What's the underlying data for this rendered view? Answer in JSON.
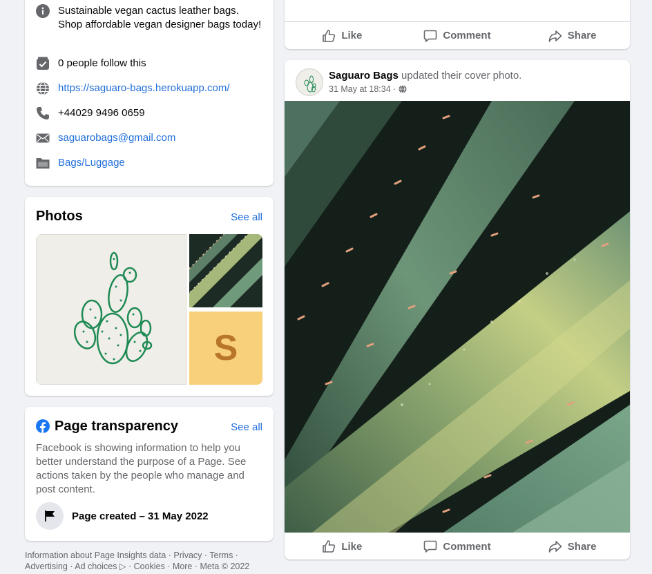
{
  "about": {
    "description": "Sustainable vegan cactus leather bags. Shop affordable vegan designer bags today!",
    "followers": "0 people follow this",
    "website": "https://saguaro-bags.herokuapp.com/",
    "phone": "+44029 9496 0659",
    "email": "saguarobags@gmail.com",
    "category": "Bags/Luggage"
  },
  "photos": {
    "title": "Photos",
    "see_all": "See all",
    "tile_letter": "S"
  },
  "transparency": {
    "title": "Page transparency",
    "see_all": "See all",
    "body": "Facebook is showing information to help you better understand the purpose of a Page. See actions taken by the people who manage and post content.",
    "created": "Page created – 31 May 2022"
  },
  "footer": {
    "links": [
      "Information about Page Insights data",
      "Privacy",
      "Terms",
      "Advertising",
      "Ad choices",
      "Cookies",
      "More"
    ],
    "copyright": "Meta © 2022"
  },
  "post_actions": {
    "like": "Like",
    "comment": "Comment",
    "share": "Share"
  },
  "post": {
    "author": "Saguaro Bags",
    "action": "updated their cover photo.",
    "timestamp": "31 May at 18:34 ·"
  },
  "colors": {
    "link": "#216fdb",
    "muted": "#65676b",
    "background": "#f0f2f5",
    "facebook_blue": "#1877f2"
  }
}
